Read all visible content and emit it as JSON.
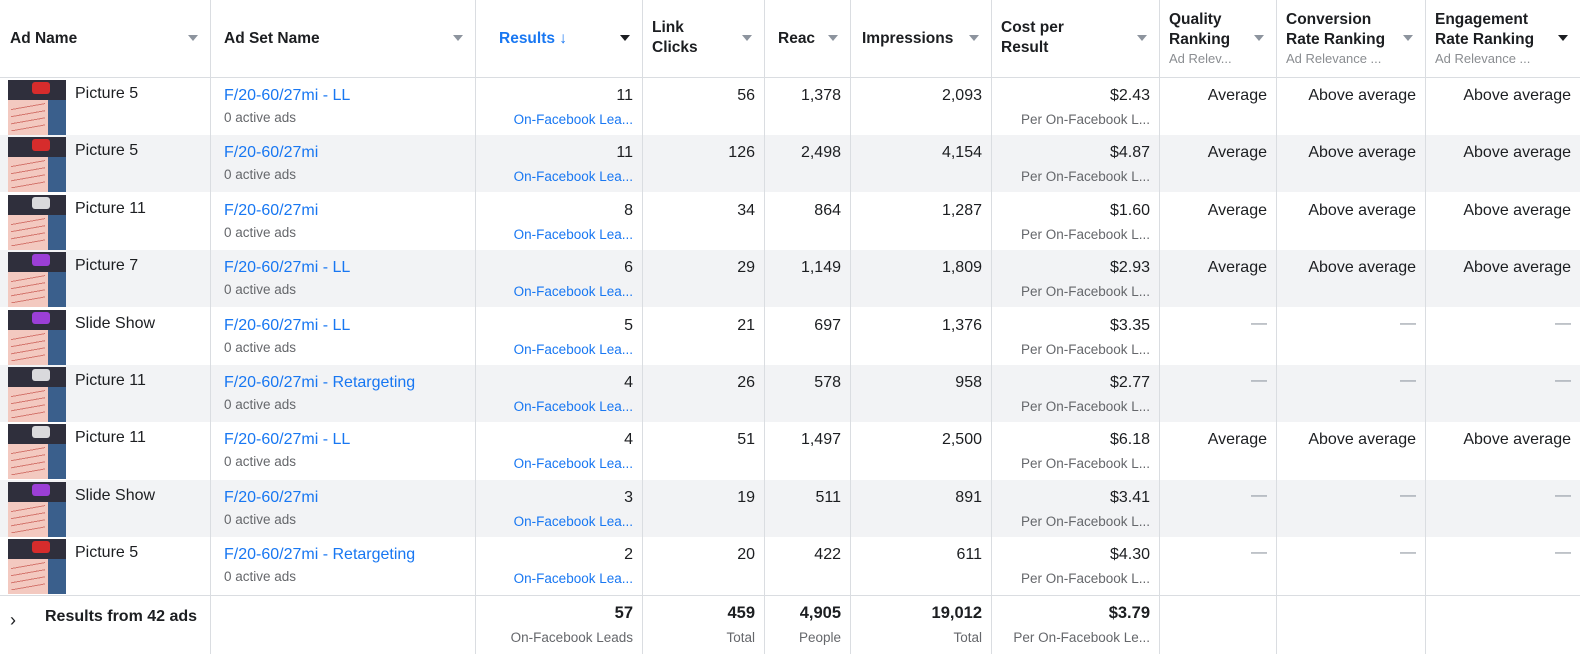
{
  "columns": [
    {
      "key": "ad_name",
      "title": "Ad Name"
    },
    {
      "key": "ad_set_name",
      "title": "Ad Set Name"
    },
    {
      "key": "results",
      "title": "Results ↓",
      "sorted": true
    },
    {
      "key": "link_clicks",
      "title": "Link Clicks"
    },
    {
      "key": "reach",
      "title": "Reac"
    },
    {
      "key": "impressions",
      "title": "Impressions"
    },
    {
      "key": "cost_per_result",
      "title": "Cost per Result"
    },
    {
      "key": "quality_ranking",
      "title": "Quality Ranking",
      "sub": "Ad Relev..."
    },
    {
      "key": "conversion_rate_ranking",
      "title": "Conversion Rate Ranking",
      "sub": "Ad Relevance ..."
    },
    {
      "key": "engagement_rate_ranking",
      "title": "Engagement Rate Ranking",
      "sub": "Ad Relevance ..."
    }
  ],
  "rows": [
    {
      "ad_name": "Picture 5",
      "thumb": "red",
      "ad_set": "F/20-60/27mi - LL",
      "ad_set_sub": "0 active ads",
      "results": "11",
      "results_sub": "On-Facebook Lea...",
      "link_clicks": "56",
      "reach": "1,378",
      "impressions": "2,093",
      "cost": "$2.43",
      "cost_sub": "Per On-Facebook L...",
      "quality": "Average",
      "conversion": "Above average",
      "engagement": "Above average"
    },
    {
      "ad_name": "Picture 5",
      "thumb": "red",
      "ad_set": "F/20-60/27mi",
      "ad_set_sub": "0 active ads",
      "results": "11",
      "results_sub": "On-Facebook Lea...",
      "link_clicks": "126",
      "reach": "2,498",
      "impressions": "4,154",
      "cost": "$4.87",
      "cost_sub": "Per On-Facebook L...",
      "quality": "Average",
      "conversion": "Above average",
      "engagement": "Above average"
    },
    {
      "ad_name": "Picture 11",
      "thumb": "white",
      "ad_set": "F/20-60/27mi",
      "ad_set_sub": "0 active ads",
      "results": "8",
      "results_sub": "On-Facebook Lea...",
      "link_clicks": "34",
      "reach": "864",
      "impressions": "1,287",
      "cost": "$1.60",
      "cost_sub": "Per On-Facebook L...",
      "quality": "Average",
      "conversion": "Above average",
      "engagement": "Above average"
    },
    {
      "ad_name": "Picture 7",
      "thumb": "purple",
      "ad_set": "F/20-60/27mi - LL",
      "ad_set_sub": "0 active ads",
      "results": "6",
      "results_sub": "On-Facebook Lea...",
      "link_clicks": "29",
      "reach": "1,149",
      "impressions": "1,809",
      "cost": "$2.93",
      "cost_sub": "Per On-Facebook L...",
      "quality": "Average",
      "conversion": "Above average",
      "engagement": "Above average"
    },
    {
      "ad_name": "Slide Show",
      "thumb": "purple",
      "ad_set": "F/20-60/27mi - LL",
      "ad_set_sub": "0 active ads",
      "results": "5",
      "results_sub": "On-Facebook Lea...",
      "link_clicks": "21",
      "reach": "697",
      "impressions": "1,376",
      "cost": "$3.35",
      "cost_sub": "Per On-Facebook L...",
      "quality": "—",
      "conversion": "—",
      "engagement": "—"
    },
    {
      "ad_name": "Picture 11",
      "thumb": "white",
      "ad_set": "F/20-60/27mi - Retargeting",
      "ad_set_sub": "0 active ads",
      "results": "4",
      "results_sub": "On-Facebook Lea...",
      "link_clicks": "26",
      "reach": "578",
      "impressions": "958",
      "cost": "$2.77",
      "cost_sub": "Per On-Facebook L...",
      "quality": "—",
      "conversion": "—",
      "engagement": "—"
    },
    {
      "ad_name": "Picture 11",
      "thumb": "white",
      "ad_set": "F/20-60/27mi - LL",
      "ad_set_sub": "0 active ads",
      "results": "4",
      "results_sub": "On-Facebook Lea...",
      "link_clicks": "51",
      "reach": "1,497",
      "impressions": "2,500",
      "cost": "$6.18",
      "cost_sub": "Per On-Facebook L...",
      "quality": "Average",
      "conversion": "Above average",
      "engagement": "Above average"
    },
    {
      "ad_name": "Slide Show",
      "thumb": "purple",
      "ad_set": "F/20-60/27mi",
      "ad_set_sub": "0 active ads",
      "results": "3",
      "results_sub": "On-Facebook Lea...",
      "link_clicks": "19",
      "reach": "511",
      "impressions": "891",
      "cost": "$3.41",
      "cost_sub": "Per On-Facebook L...",
      "quality": "—",
      "conversion": "—",
      "engagement": "—"
    },
    {
      "ad_name": "Picture 5",
      "thumb": "red",
      "ad_set": "F/20-60/27mi - Retargeting",
      "ad_set_sub": "0 active ads",
      "results": "2",
      "results_sub": "On-Facebook Lea...",
      "link_clicks": "20",
      "reach": "422",
      "impressions": "611",
      "cost": "$4.30",
      "cost_sub": "Per On-Facebook L...",
      "quality": "—",
      "conversion": "—",
      "engagement": "—"
    }
  ],
  "footer": {
    "expand_icon": "chevron-right-icon",
    "label": "Results from 42 ads",
    "results": "57",
    "results_sub": "On-Facebook Leads",
    "link_clicks": "459",
    "link_clicks_sub": "Total",
    "reach": "4,905",
    "reach_sub": "People",
    "impressions": "19,012",
    "impressions_sub": "Total",
    "cost": "$3.79",
    "cost_sub": "Per On-Facebook Le..."
  },
  "colors": {
    "link": "#1877f2",
    "alt_row": "#f2f3f5",
    "grid": "#dadde1",
    "muted": "#65676b"
  }
}
